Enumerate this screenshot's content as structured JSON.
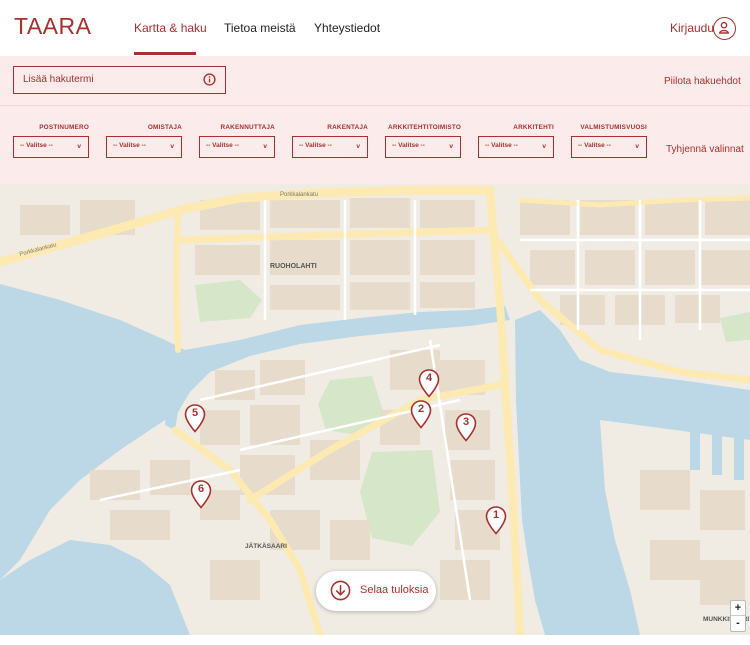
{
  "header": {
    "logo": "TAARA",
    "nav": [
      {
        "label": "Kartta & haku",
        "active": true
      },
      {
        "label": "Tietoa meistä",
        "active": false
      },
      {
        "label": "Yhteystiedot",
        "active": false
      }
    ],
    "login_label": "Kirjaudu",
    "login_icon": "user-circle-icon"
  },
  "search": {
    "placeholder": "Lisää hakutermi",
    "info_icon": "info-icon",
    "hide_label": "Piilota hakuehdot"
  },
  "filters": {
    "items": [
      {
        "label": "POSTINUMERO",
        "value": "-- Valitse --"
      },
      {
        "label": "OMISTAJA",
        "value": "-- Valitse --"
      },
      {
        "label": "RAKENNUTTAJA",
        "value": "-- Valitse --"
      },
      {
        "label": "RAKENTAJA",
        "value": "-- Valitse --"
      },
      {
        "label": "ARKKITEHTITOIMISTO",
        "value": "-- Valitse --"
      },
      {
        "label": "ARKKITEHTI",
        "value": "-- Valitse --"
      },
      {
        "label": "VALMISTUMISVUOSI",
        "value": "-- Valitse --"
      }
    ],
    "chevron": "v",
    "clear_label": "Tyhjennä valinnat"
  },
  "map": {
    "place_labels": [
      "Porkkalankatu",
      "RUOHOLAHTI",
      "JÄTKÄSAARI",
      "MUNKKISAARI"
    ],
    "markers": [
      "1",
      "2",
      "3",
      "4",
      "5",
      "6"
    ],
    "colors": {
      "water": "#bcd7e6",
      "land": "#f0ece4",
      "building": "#e7dccc",
      "park": "#d5e6c9",
      "road": "#fde9b2",
      "accent": "#a8302f"
    }
  },
  "browse": {
    "label": "Selaa tuloksia",
    "icon": "arrow-down-circle-icon"
  },
  "zoom": {
    "in_label": "+",
    "out_label": "-"
  }
}
